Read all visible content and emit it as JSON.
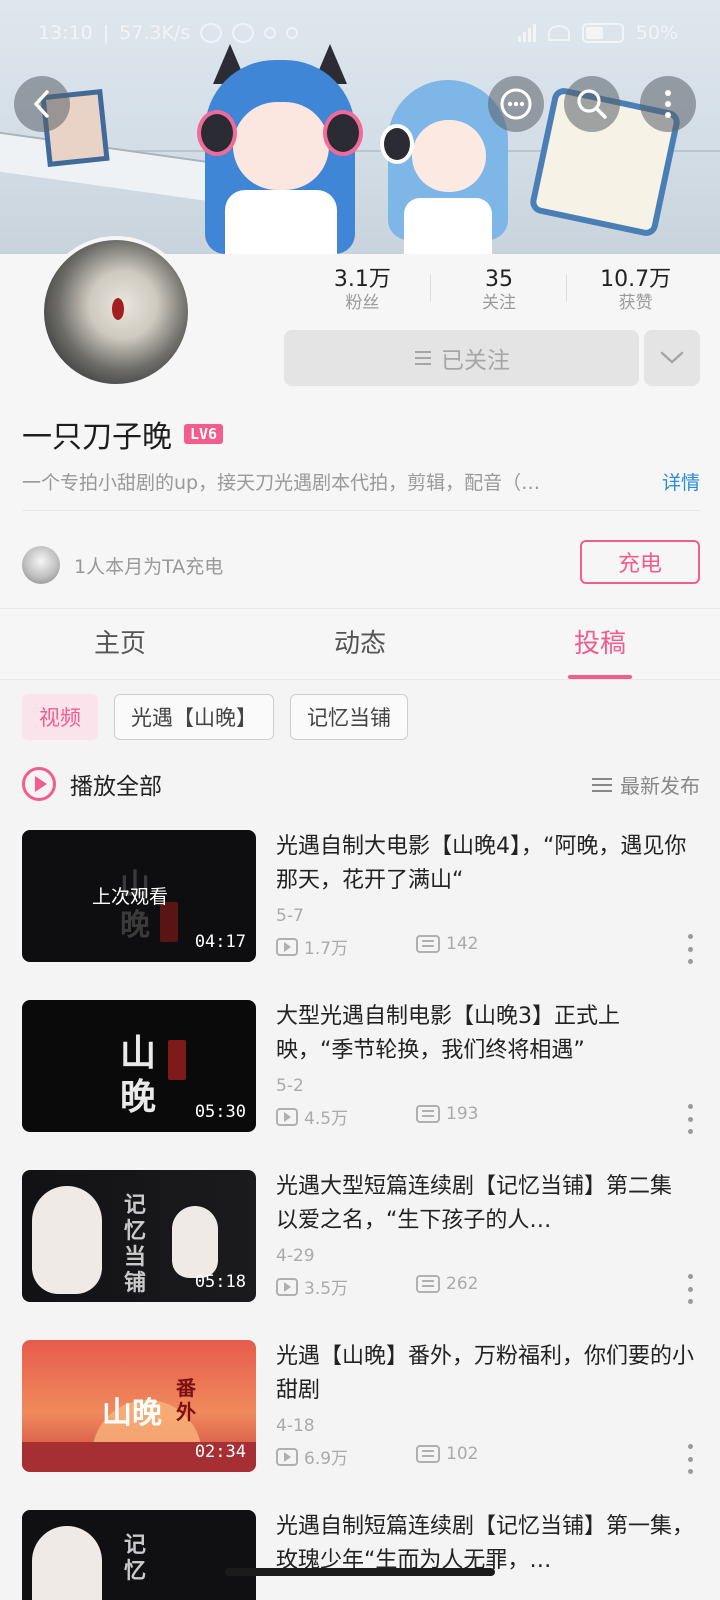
{
  "status_bar": {
    "time": "13:10",
    "network_speed": "57.3K/s",
    "battery": "50%"
  },
  "icons": {
    "back": "back-arrow-icon",
    "message": "message-icon",
    "search": "search-icon",
    "more": "more-vertical-icon"
  },
  "profile": {
    "stats": [
      {
        "value": "3.1万",
        "label": "粉丝"
      },
      {
        "value": "35",
        "label": "关注"
      },
      {
        "value": "10.7万",
        "label": "获赞"
      }
    ],
    "follow_label": "已关注",
    "username": "一只刀子晚",
    "level": "LV6",
    "bio": "一个专拍小甜剧的up，接天刀光遇剧本代拍，剪辑，配音（…",
    "bio_more": "详情",
    "charge_text": "1人本月为TA充电",
    "charge_button": "充电"
  },
  "colors": {
    "accent": "#f25d8e",
    "link": "#2a8bd8"
  },
  "tabs": [
    {
      "label": "主页",
      "active": false
    },
    {
      "label": "动态",
      "active": false
    },
    {
      "label": "投稿",
      "active": true
    }
  ],
  "filters": [
    {
      "label": "视频",
      "active": true
    },
    {
      "label": "光遇【山晚】",
      "active": false
    },
    {
      "label": "记忆当铺",
      "active": false
    }
  ],
  "playall": {
    "label": "播放全部",
    "sort_label": "最新发布"
  },
  "videos": [
    {
      "title": "光遇自制大电影【山晚4】，“阿晚，遇见你那天，花开了满山“",
      "date": "5-7",
      "views": "1.7万",
      "danmaku": "142",
      "duration": "04:17",
      "overlay": "上次观看"
    },
    {
      "title": "大型光遇自制电影【山晚3】正式上映，“季节轮换，我们终将相遇”",
      "date": "5-2",
      "views": "4.5万",
      "danmaku": "193",
      "duration": "05:30"
    },
    {
      "title": "光遇大型短篇连续剧【记忆当铺】第二集 以爱之名，“生下孩子的人…",
      "date": "4-29",
      "views": "3.5万",
      "danmaku": "262",
      "duration": "05:18"
    },
    {
      "title": "光遇【山晚】番外，万粉福利，你们要的小甜剧",
      "date": "4-18",
      "views": "6.9万",
      "danmaku": "102",
      "duration": "02:34"
    },
    {
      "title": "光遇自制短篇连续剧【记忆当铺】第一集，玫瑰少年“生而为人无罪，…",
      "date": "",
      "views": "",
      "danmaku": "",
      "duration": ""
    }
  ]
}
